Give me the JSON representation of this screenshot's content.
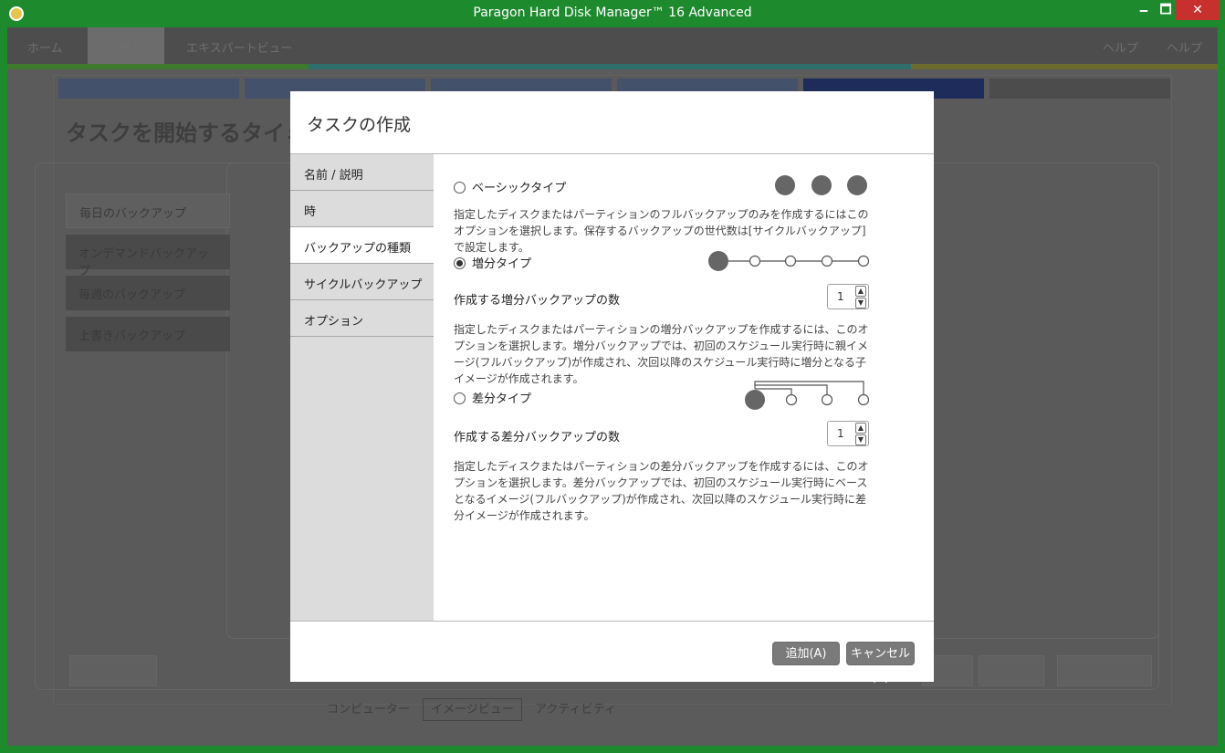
{
  "window": {
    "title": "Paragon Hard Disk Manager™ 16 Advanced",
    "minimize_glyph": "🗕",
    "maximize_glyph": "🗖",
    "close_glyph": "✕"
  },
  "background_app": {
    "menu": [
      "ホーム",
      "ツール",
      "エキスパートビュー"
    ],
    "menu_right": [
      "ヘルプ",
      "ヘルプ"
    ],
    "page_title": "タスクを開始するタイミン",
    "left_list": [
      "毎日のバックアップ",
      "オンデマンドバックアップ",
      "毎週のバックアップ",
      "上書きバックアップ"
    ],
    "bottom_tabs": [
      "コンピューター",
      "イメージビュー",
      "アクティビティ"
    ]
  },
  "dialog": {
    "title": "タスクの作成",
    "nav": [
      {
        "label": "名前 / 説明"
      },
      {
        "label": "時"
      },
      {
        "label": "バックアップの種類"
      },
      {
        "label": "サイクルバックアップ"
      },
      {
        "label": "オプション"
      }
    ],
    "active_nav_index": 2,
    "options": {
      "basic": {
        "label": "ベーシックタイプ",
        "selected": false,
        "description": "指定したディスクまたはパーティションのフルバックアップのみを作成するにはこのオプションを選択します。保存するバックアップの世代数は[サイクルバックアップ]で設定します。"
      },
      "incremental": {
        "label": "増分タイプ",
        "selected": true,
        "count_label": "作成する増分バックアップの数",
        "count_value": "1",
        "description": "指定したディスクまたはパーティションの増分バックアップを作成するには、このオプションを選択します。増分バックアップでは、初回のスケジュール実行時に親イメージ(フルバックアップ)が作成され、次回以降のスケジュール実行時に増分となる子イメージが作成されます。"
      },
      "differential": {
        "label": "差分タイプ",
        "selected": false,
        "count_label": "作成する差分バックアップの数",
        "count_value": "1",
        "description": "指定したディスクまたはパーティションの差分バックアップを作成するには、このオプションを選択します。差分バックアップでは、初回のスケジュール実行時にベースとなるイメージ(フルバックアップ)が作成され、次回以降のスケジュール実行時に差分イメージが作成されます。"
      }
    },
    "stepper_up_glyph": "▲",
    "stepper_down_glyph": "▼",
    "buttons": {
      "add": "追加(A)",
      "cancel": "キャンセル(C)"
    }
  },
  "colors": {
    "title_bar": "#1e8a2e",
    "close_button": "#c7302c",
    "dialog_nav_bg": "#dcdcdc",
    "button_bg": "#7a7a7a",
    "diagram_fill": "#666666"
  }
}
